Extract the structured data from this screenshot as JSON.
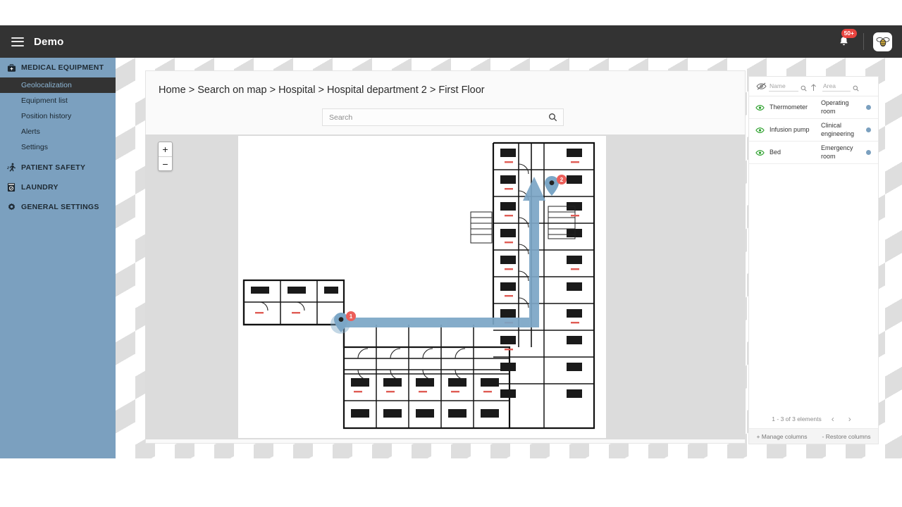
{
  "header": {
    "brand": "Demo",
    "menu_icon": "hamburger-icon",
    "notification_icon": "bell-icon",
    "notification_count": "50+",
    "app_logo_icon": "bee-logo-icon"
  },
  "sidebar": {
    "groups": [
      {
        "label": "MEDICAL EQUIPMENT",
        "icon": "medical-bag-icon",
        "items": [
          {
            "label": "Geolocalization",
            "active": true
          },
          {
            "label": "Equipment list",
            "active": false
          },
          {
            "label": "Position history",
            "active": false
          },
          {
            "label": "Alerts",
            "active": false
          },
          {
            "label": "Settings",
            "active": false
          }
        ]
      },
      {
        "label": "PATIENT SAFETY",
        "icon": "running-person-icon",
        "items": []
      },
      {
        "label": "LAUNDRY",
        "icon": "washing-machine-icon",
        "items": []
      },
      {
        "label": "GENERAL SETTINGS",
        "icon": "gear-icon",
        "items": []
      }
    ]
  },
  "main": {
    "breadcrumb": "Home > Search on map > Hospital > Hospital department 2 > First Floor",
    "search": {
      "placeholder": "Search",
      "value": "",
      "icon": "search-icon"
    },
    "map": {
      "zoom_in_label": "+",
      "zoom_out_label": "−",
      "markers": [
        {
          "name": "marker-upper",
          "badge": "2",
          "halo": false
        },
        {
          "name": "marker-lower",
          "badge": "1",
          "halo": true
        }
      ],
      "route_color": "#7ba6c6"
    }
  },
  "panel": {
    "visibility_icon": "eye-off-icon",
    "columns": {
      "name": {
        "placeholder": "Name",
        "value": "",
        "search_icon": "search-icon",
        "sort_icon": "sort-asc-icon"
      },
      "area": {
        "placeholder": "Area",
        "value": "",
        "search_icon": "search-icon"
      }
    },
    "rows": [
      {
        "eye_icon": "eye-icon",
        "name": "Thermometer",
        "area": "Operating room",
        "status_color": "#7ba0bf"
      },
      {
        "eye_icon": "eye-icon",
        "name": "Infusion pump",
        "area": "Clinical engineering",
        "status_color": "#7ba0bf"
      },
      {
        "eye_icon": "eye-icon",
        "name": "Bed",
        "area": "Emergency room",
        "status_color": "#7ba0bf"
      }
    ],
    "pagination": {
      "summary": "1 - 3 of 3 elements",
      "prev_icon": "chevron-left-icon",
      "next_icon": "chevron-right-icon"
    },
    "manage_columns": "+ Manage columns",
    "restore_columns": "- Restore columns"
  }
}
